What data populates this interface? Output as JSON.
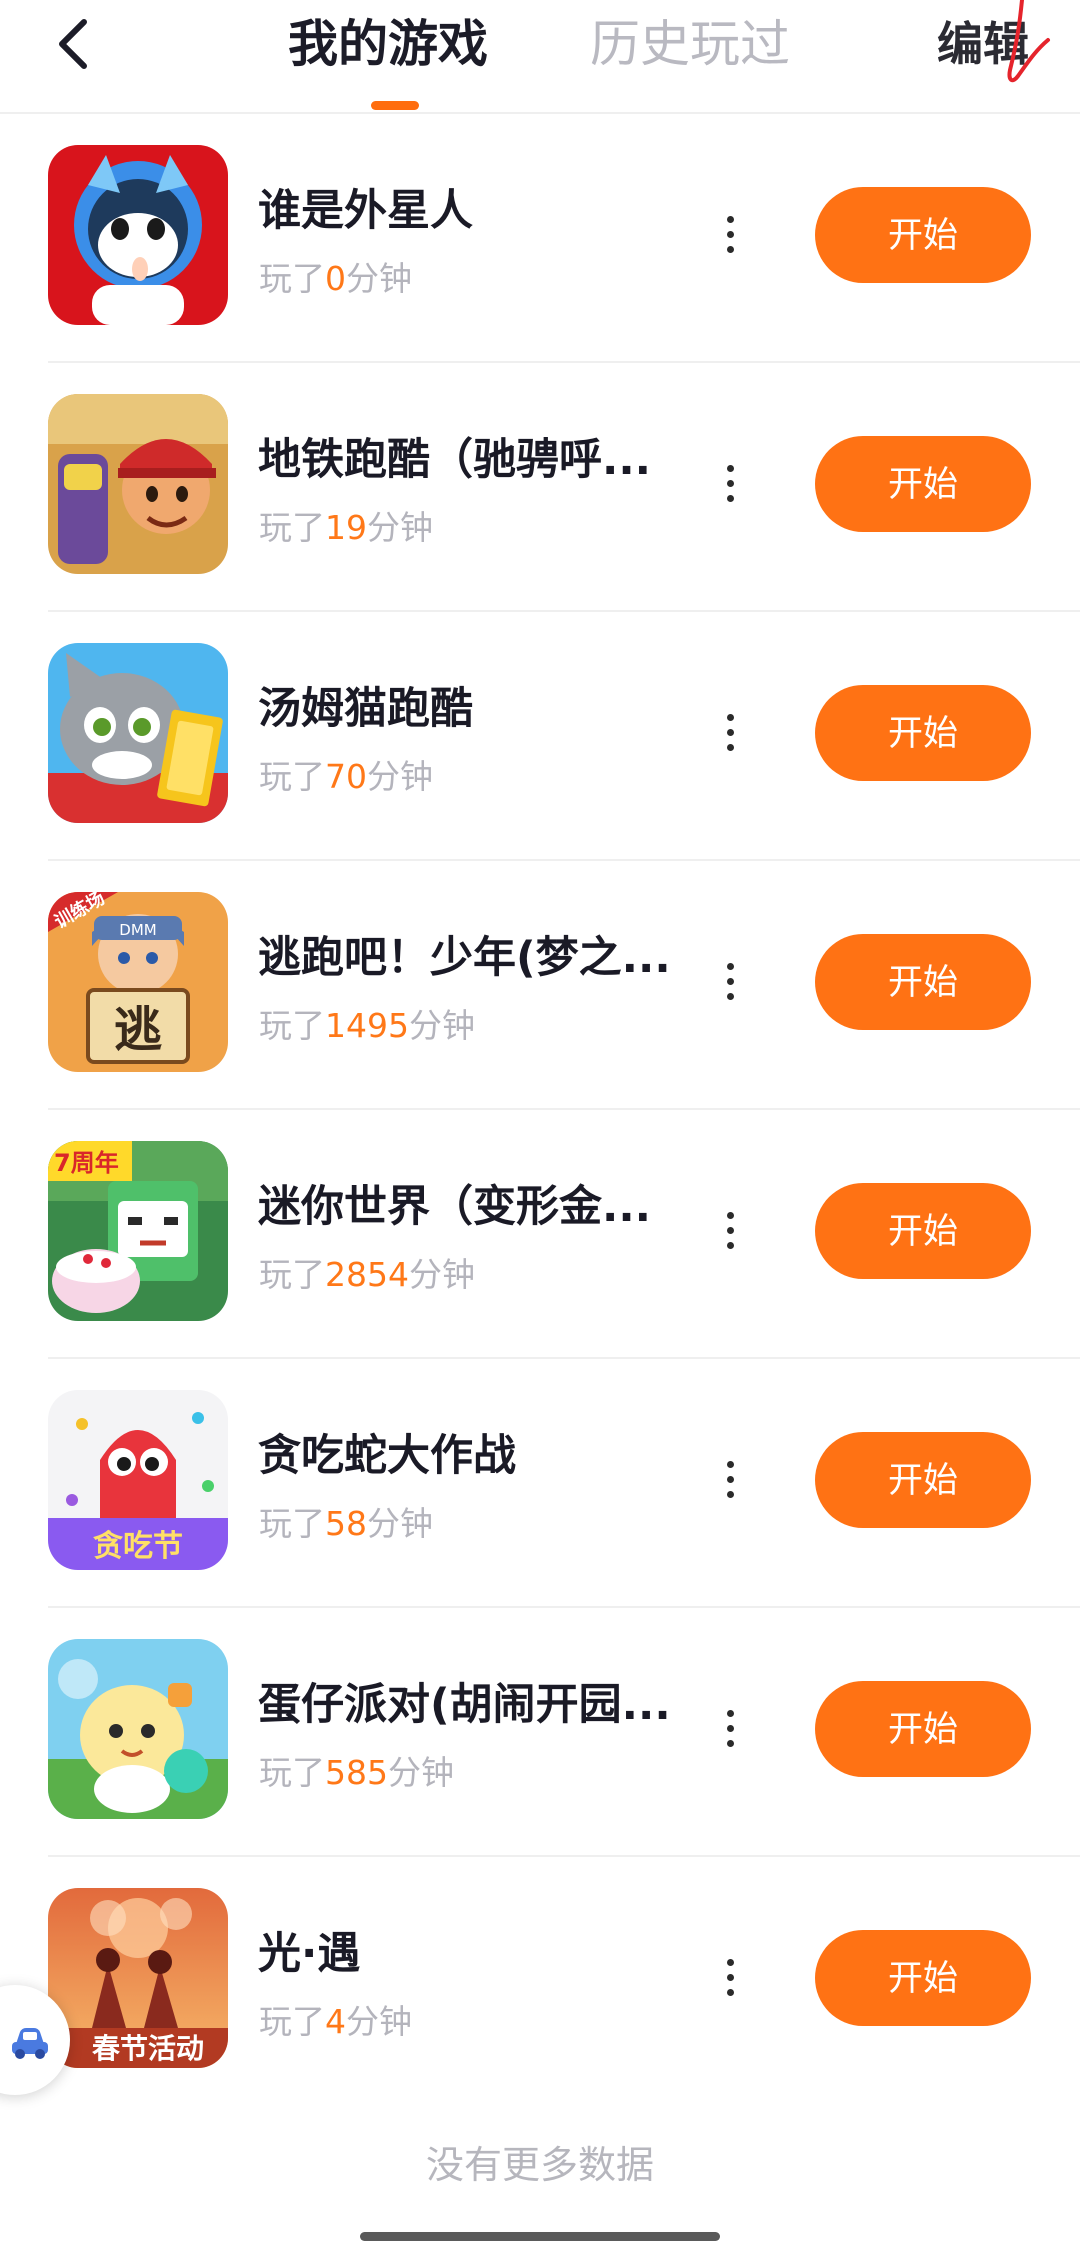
{
  "header": {
    "tabs": [
      {
        "label": "我的游戏",
        "active": true
      },
      {
        "label": "历史玩过",
        "active": false
      }
    ],
    "edit_label": "编辑"
  },
  "colors": {
    "accent": "#ff7214",
    "minutes_highlight": "#ff7818",
    "annotation_stroke": "#e5242c"
  },
  "games": [
    {
      "title": "谁是外星人",
      "time_prefix": "玩了",
      "minutes": "0",
      "time_suffix": "分钟",
      "action": "开始",
      "icon": "cat-astronaut-icon"
    },
    {
      "title": "地铁跑酷（驰骋呼...",
      "time_prefix": "玩了",
      "minutes": "19",
      "time_suffix": "分钟",
      "action": "开始",
      "icon": "subway-runner-icon"
    },
    {
      "title": "汤姆猫跑酷",
      "time_prefix": "玩了",
      "minutes": "70",
      "time_suffix": "分钟",
      "action": "开始",
      "icon": "tom-cat-gold-icon"
    },
    {
      "title": "逃跑吧！少年(梦之...",
      "time_prefix": "玩了",
      "minutes": "1495",
      "time_suffix": "分钟",
      "action": "开始",
      "icon": "escape-boy-icon",
      "icon_badge": "训练场",
      "icon_cap": "DMM",
      "icon_text": "逃"
    },
    {
      "title": "迷你世界（变形金...",
      "time_prefix": "玩了",
      "minutes": "2854",
      "time_suffix": "分钟",
      "action": "开始",
      "icon": "mini-world-block-icon",
      "icon_badge": "7周年"
    },
    {
      "title": "贪吃蛇大作战",
      "time_prefix": "玩了",
      "minutes": "58",
      "time_suffix": "分钟",
      "action": "开始",
      "icon": "snake-ghost-icon",
      "icon_text": "贪吃节"
    },
    {
      "title": "蛋仔派对(胡闹开园...",
      "time_prefix": "玩了",
      "minutes": "585",
      "time_suffix": "分钟",
      "action": "开始",
      "icon": "eggy-party-icon"
    },
    {
      "title": "光·遇",
      "time_prefix": "玩了",
      "minutes": "4",
      "time_suffix": "分钟",
      "action": "开始",
      "icon": "sky-children-icon",
      "icon_text": "春节活动"
    }
  ],
  "footer": {
    "no_more_text": "没有更多数据"
  }
}
